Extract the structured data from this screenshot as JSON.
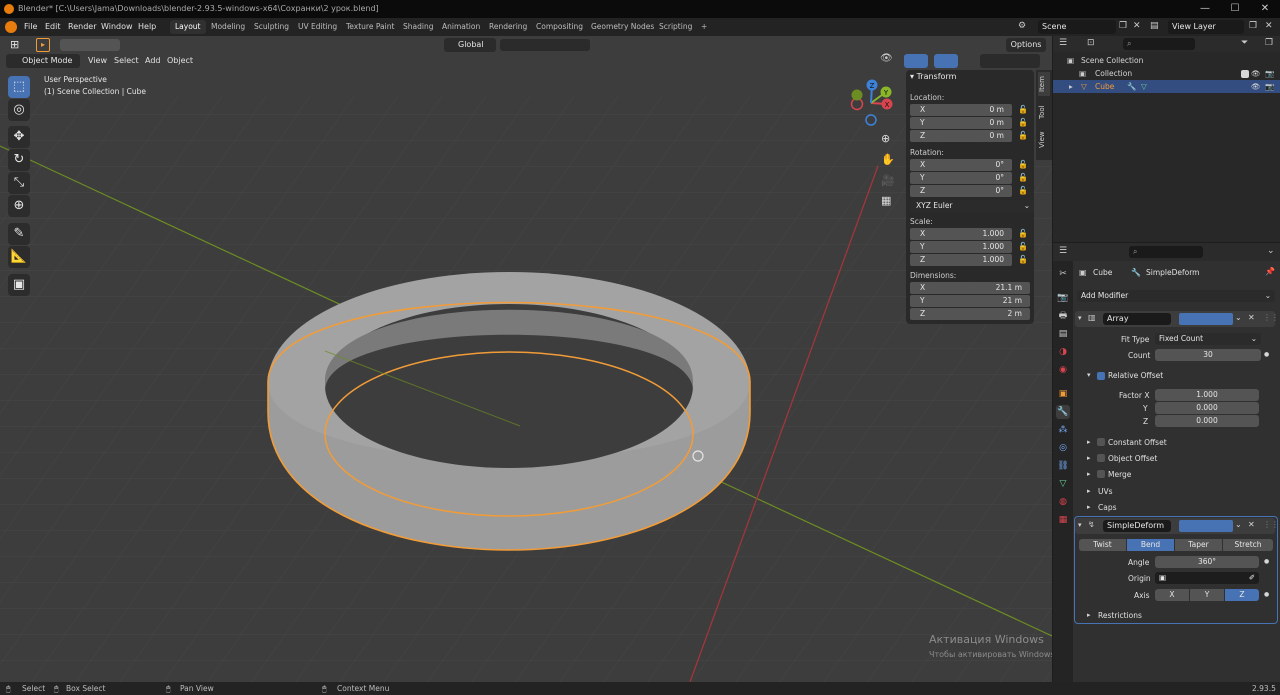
{
  "titlebar": {
    "title": "Blender* [C:\\Users\\Jama\\Downloads\\blender-2.93.5-windows-x64\\Сохранки\\2 урок.blend]",
    "controls": [
      "—",
      "☐",
      "✕"
    ]
  },
  "menu": [
    "File",
    "Edit",
    "Render",
    "Window",
    "Help"
  ],
  "workspaces": [
    "Layout",
    "Modeling",
    "Sculpting",
    "UV Editing",
    "Texture Paint",
    "Shading",
    "Animation",
    "Rendering",
    "Compositing",
    "Geometry Nodes",
    "Scripting",
    "+"
  ],
  "scene": {
    "name": "Scene",
    "view_layer": "View Layer"
  },
  "tool_header": {
    "orientation": "Global",
    "options": "Options"
  },
  "viewport": {
    "mode": "Object Mode",
    "menus": [
      "View",
      "Select",
      "Add",
      "Object"
    ],
    "info_line1": "User Perspective",
    "info_line2": "(1) Scene Collection | Cube",
    "watermark_title": "Активация Windows",
    "watermark_text": "Чтобы активировать Windows, перейдите в раздел \"Параметры\"."
  },
  "gizmo": {
    "x": "X",
    "y": "Y",
    "z": "Z"
  },
  "npanel": {
    "title": "Transform",
    "tabs": [
      "Item",
      "Tool",
      "View"
    ],
    "location_label": "Location:",
    "location": [
      {
        "axis": "X",
        "value": "0 m"
      },
      {
        "axis": "Y",
        "value": "0 m"
      },
      {
        "axis": "Z",
        "value": "0 m"
      }
    ],
    "rotation_label": "Rotation:",
    "rotation": [
      {
        "axis": "X",
        "value": "0°"
      },
      {
        "axis": "Y",
        "value": "0°"
      },
      {
        "axis": "Z",
        "value": "0°"
      }
    ],
    "rotation_mode": "XYZ Euler",
    "scale_label": "Scale:",
    "scale": [
      {
        "axis": "X",
        "value": "1.000"
      },
      {
        "axis": "Y",
        "value": "1.000"
      },
      {
        "axis": "Z",
        "value": "1.000"
      }
    ],
    "dimensions_label": "Dimensions:",
    "dimensions": [
      {
        "axis": "X",
        "value": "21.1 m"
      },
      {
        "axis": "Y",
        "value": "21 m"
      },
      {
        "axis": "Z",
        "value": "2 m"
      }
    ]
  },
  "outliner": {
    "items": [
      {
        "label": "Scene Collection"
      },
      {
        "label": "Collection"
      },
      {
        "label": "Cube"
      }
    ]
  },
  "properties": {
    "object_name": "Cube",
    "modifier_context": "SimpleDeform",
    "add_modifier": "Add Modifier",
    "array": {
      "name": "Array",
      "fit_type_label": "Fit Type",
      "fit_type": "Fixed Count",
      "count_label": "Count",
      "count": "30",
      "relative_offset_label": "Relative Offset",
      "factor_labels": [
        "Factor X",
        "Y",
        "Z"
      ],
      "factors": [
        "1.000",
        "0.000",
        "0.000"
      ],
      "sub_panels": [
        "Constant Offset",
        "Object Offset",
        "Merge",
        "UVs",
        "Caps"
      ]
    },
    "simple_deform": {
      "name": "SimpleDeform",
      "modes": [
        "Twist",
        "Bend",
        "Taper",
        "Stretch"
      ],
      "active_mode": "Bend",
      "angle_label": "Angle",
      "angle": "360°",
      "origin_label": "Origin",
      "axis_label": "Axis",
      "axes": [
        "X",
        "Y",
        "Z"
      ],
      "active_axis": "Z",
      "restrictions": "Restrictions"
    }
  },
  "statusbar": {
    "items": [
      "Select",
      "Box Select",
      "Pan View",
      "Context Menu"
    ],
    "version": "2.93.5"
  },
  "colors": {
    "accent": "#4772b3",
    "selection_outline": "#f29c38",
    "x_axis": "#d8454f",
    "y_axis": "#8ab62a",
    "z_axis": "#3d82d9"
  }
}
